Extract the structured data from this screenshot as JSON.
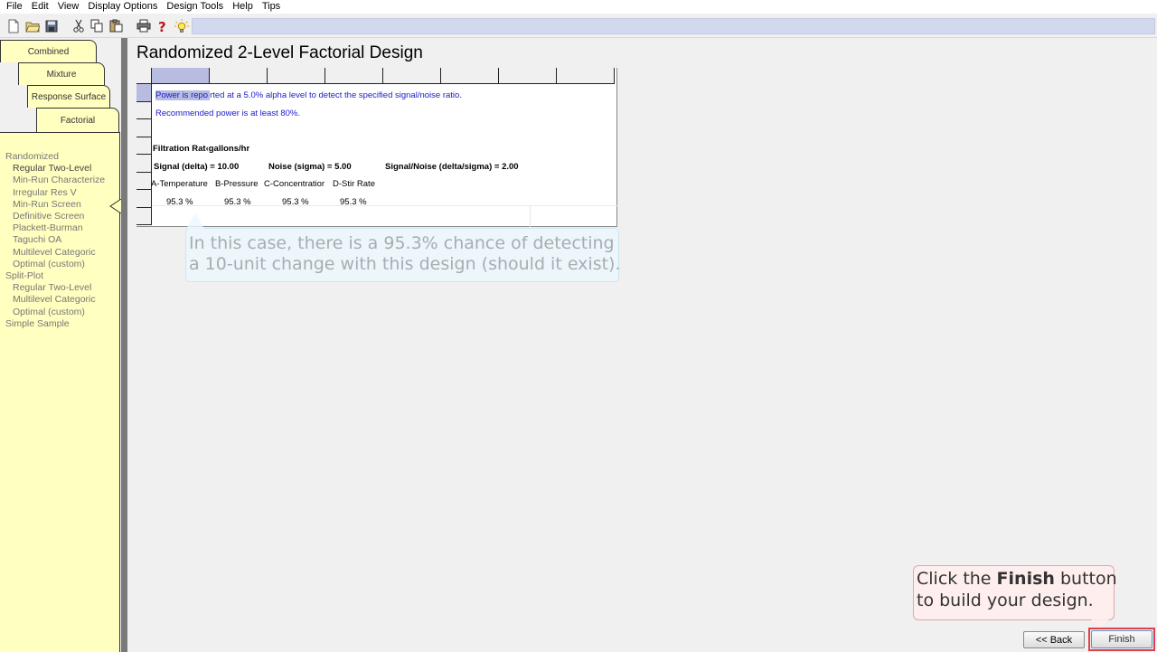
{
  "menu": [
    "File",
    "Edit",
    "View",
    "Display Options",
    "Design Tools",
    "Help",
    "Tips"
  ],
  "toolbar": {
    "icons": [
      "new-file-icon",
      "open-folder-icon",
      "save-icon",
      "cut-icon",
      "copy-icon",
      "paste-icon",
      "print-icon",
      "help-icon",
      "tip-bulb-icon"
    ]
  },
  "tabs": {
    "combined": "Combined",
    "mixture": "Mixture",
    "response_surface": "Response Surface",
    "factorial": "Factorial"
  },
  "tree": [
    {
      "label": "Randomized",
      "level": 0
    },
    {
      "label": "Regular Two-Level",
      "level": 1,
      "selected": true
    },
    {
      "label": "Min-Run Characterize",
      "level": 1
    },
    {
      "label": "Irregular Res V",
      "level": 1
    },
    {
      "label": "Min-Run Screen",
      "level": 1
    },
    {
      "label": "Definitive Screen",
      "level": 1
    },
    {
      "label": "Plackett-Burman",
      "level": 1
    },
    {
      "label": "Taguchi OA",
      "level": 1
    },
    {
      "label": "Multilevel Categoric",
      "level": 1
    },
    {
      "label": "Optimal (custom)",
      "level": 1
    },
    {
      "label": "Split-Plot",
      "level": 0
    },
    {
      "label": "Regular Two-Level",
      "level": 1
    },
    {
      "label": "Multilevel Categoric",
      "level": 1
    },
    {
      "label": "Optimal (custom)",
      "level": 1
    },
    {
      "label": "Simple Sample",
      "level": 0
    }
  ],
  "main": {
    "title": "Randomized 2-Level Factorial Design",
    "power_note_hl": "Power is repo",
    "power_note_rest": "rted at a 5.0% alpha level to detect the specified signal/noise ratio.",
    "recommended": "Recommended power is at least 80%.",
    "response": "Filtration Rat‹gallons/hr",
    "signal": "Signal (delta) = 10.00",
    "noise": "Noise (sigma) = 5.00",
    "snr": "Signal/Noise (delta/sigma) = 2.00",
    "factors": [
      {
        "name": "A-Temperature",
        "power": "95.3 %"
      },
      {
        "name": "B-Pressure",
        "power": "95.3 %"
      },
      {
        "name": "C-Concentratior",
        "power": "95.3 %"
      },
      {
        "name": "D-Stir Rate",
        "power": "95.3 %"
      }
    ]
  },
  "callouts": {
    "power_line1": "In this case, there is a 95.3% chance of detecting",
    "power_line2": "a 10-unit change with this design (should it exist).",
    "finish_pre": "Click the ",
    "finish_bold": "Finish",
    "finish_post": " button",
    "finish_line2": "to build your design."
  },
  "buttons": {
    "back": "<< Back",
    "finish": "Finish"
  }
}
